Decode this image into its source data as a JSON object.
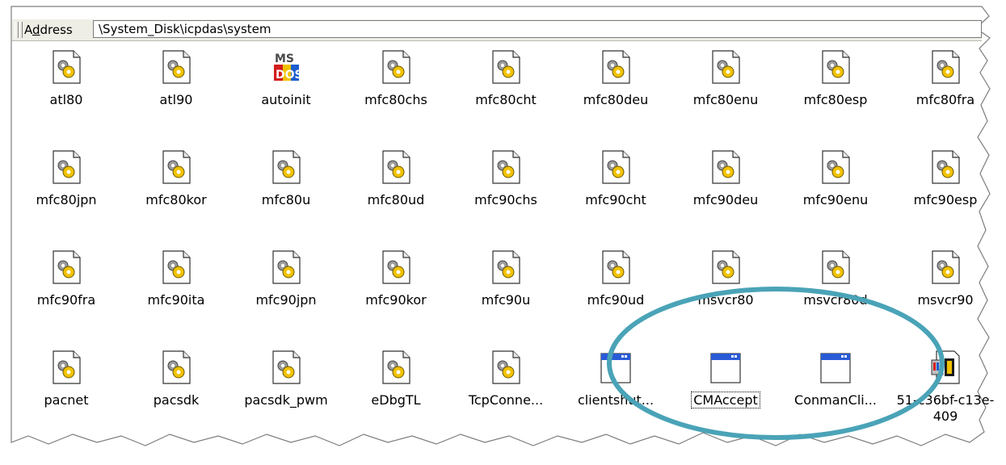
{
  "address_bar": {
    "label": "Address",
    "label_hotkey": "d",
    "path": "\\System_Disk\\icpdas\\system"
  },
  "icons": [
    {
      "label": "atl80",
      "type": "dll-gear"
    },
    {
      "label": "atl90",
      "type": "dll-gear"
    },
    {
      "label": "autoinit",
      "type": "ms-dos"
    },
    {
      "label": "mfc80chs",
      "type": "dll-gear"
    },
    {
      "label": "mfc80cht",
      "type": "dll-gear"
    },
    {
      "label": "mfc80deu",
      "type": "dll-gear"
    },
    {
      "label": "mfc80enu",
      "type": "dll-gear"
    },
    {
      "label": "mfc80esp",
      "type": "dll-gear"
    },
    {
      "label": "mfc80fra",
      "type": "dll-gear"
    },
    {
      "label": "mfc80jpn",
      "type": "dll-gear"
    },
    {
      "label": "mfc80kor",
      "type": "dll-gear"
    },
    {
      "label": "mfc80u",
      "type": "dll-gear"
    },
    {
      "label": "mfc80ud",
      "type": "dll-gear"
    },
    {
      "label": "mfc90chs",
      "type": "dll-gear"
    },
    {
      "label": "mfc90cht",
      "type": "dll-gear"
    },
    {
      "label": "mfc90deu",
      "type": "dll-gear"
    },
    {
      "label": "mfc90enu",
      "type": "dll-gear"
    },
    {
      "label": "mfc90esp",
      "type": "dll-gear"
    },
    {
      "label": "mfc90fra",
      "type": "dll-gear"
    },
    {
      "label": "mfc90ita",
      "type": "dll-gear"
    },
    {
      "label": "mfc90jpn",
      "type": "dll-gear"
    },
    {
      "label": "mfc90kor",
      "type": "dll-gear"
    },
    {
      "label": "mfc90u",
      "type": "dll-gear"
    },
    {
      "label": "mfc90ud",
      "type": "dll-gear"
    },
    {
      "label": "msvcr80",
      "type": "dll-gear"
    },
    {
      "label": "msvcr80d",
      "type": "dll-gear"
    },
    {
      "label": "msvcr90",
      "type": "dll-gear"
    },
    {
      "label": "pacnet",
      "type": "dll-gear"
    },
    {
      "label": "pacsdk",
      "type": "dll-gear"
    },
    {
      "label": "pacsdk_pwm",
      "type": "dll-gear"
    },
    {
      "label": "eDbgTL",
      "type": "dll-gear"
    },
    {
      "label": "TcpConne...",
      "type": "dll-gear"
    },
    {
      "label": "clientshut...",
      "type": "window-app"
    },
    {
      "label": "CMAccept",
      "type": "window-app",
      "focused": true
    },
    {
      "label": "ConmanCli...",
      "type": "window-app"
    },
    {
      "label": "51-c36bf-c13e-409",
      "type": "setup-file"
    }
  ],
  "colors": {
    "highlight_ellipse": "#4aa3b7",
    "address_bar_bg": "#efeee6",
    "window_titlebar": "#2a5bd7"
  }
}
